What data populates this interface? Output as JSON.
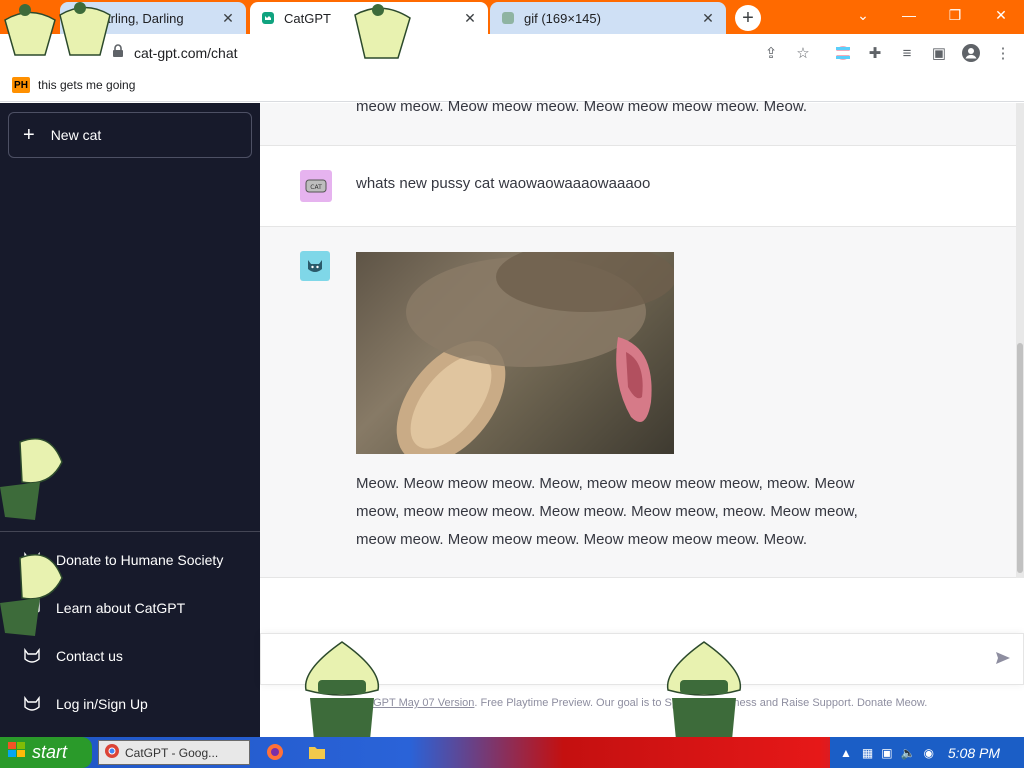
{
  "tabs": [
    {
      "title": "Darling, Darling",
      "state": "inactive",
      "favicon": "audio-tab-icon"
    },
    {
      "title": "CatGPT",
      "state": "active",
      "favicon": "catgpt-favicon"
    },
    {
      "title": "gif (169×145)",
      "state": "inactive",
      "favicon": "image-favicon"
    }
  ],
  "address_bar": {
    "url": "cat-gpt.com/chat"
  },
  "bookmarks": [
    {
      "badge": "PH",
      "label": "this gets me going"
    }
  ],
  "sidebar": {
    "new_button": "New cat",
    "items": [
      {
        "label": "Donate to Humane Society",
        "icon": "cat-icon"
      },
      {
        "label": "Learn about CatGPT",
        "icon": "cat-icon"
      },
      {
        "label": "Contact us",
        "icon": "cat-icon"
      },
      {
        "label": "Log in/Sign Up",
        "icon": "cat-icon"
      }
    ]
  },
  "chat": {
    "top_partial": "meow meow. Meow meow meow. Meow meow meow meow. Meow.",
    "user_message": "whats new pussy cat waowaowaaaowaaaoo",
    "bot_reply": "Meow. Meow meow meow. Meow, meow meow meow meow, meow. Meow meow, meow meow meow. Meow meow. Meow meow, meow. Meow meow, meow meow. Meow meow meow. Meow meow meow meow. Meow.",
    "footer_link": "CatGPT May 07 Version",
    "footer_text": ". Free Playtime Preview. Our goal is to Spread Awareness and Raise Support. Donate Meow."
  },
  "taskbar": {
    "start_label": "start",
    "task_label": "CatGPT - Goog...",
    "clock": "5:08 PM"
  },
  "colors": {
    "tabstrip": "#ff6a00",
    "sidebar_bg": "#171a2b",
    "user_avatar": "#e6b3ef",
    "bot_avatar": "#7fd7e8"
  }
}
